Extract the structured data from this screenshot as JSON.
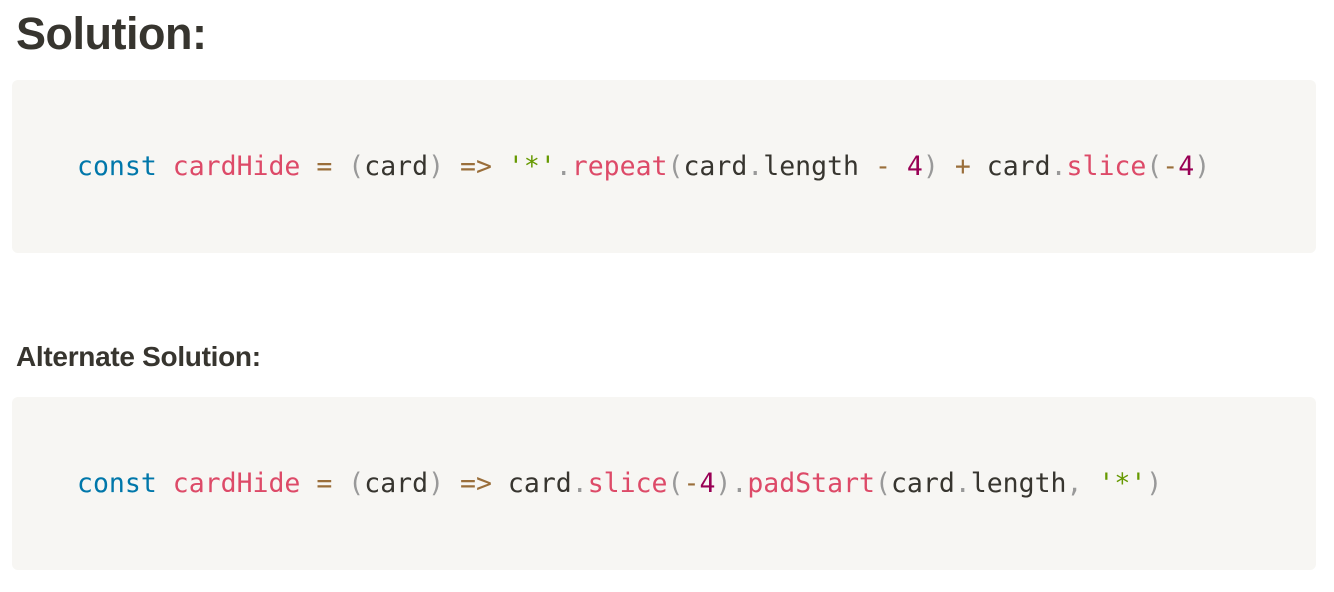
{
  "solution_heading": "Solution:",
  "alternate_heading": "Alternate Solution:",
  "code_blocks": [
    {
      "tokens": [
        {
          "text": "const",
          "kind": "kw"
        },
        {
          "text": " ",
          "kind": "id"
        },
        {
          "text": "cardHide",
          "kind": "fn"
        },
        {
          "text": " ",
          "kind": "id"
        },
        {
          "text": "=",
          "kind": "op"
        },
        {
          "text": " ",
          "kind": "id"
        },
        {
          "text": "(",
          "kind": "punc"
        },
        {
          "text": "card",
          "kind": "id"
        },
        {
          "text": ")",
          "kind": "punc"
        },
        {
          "text": " ",
          "kind": "id"
        },
        {
          "text": "=>",
          "kind": "op"
        },
        {
          "text": " ",
          "kind": "id"
        },
        {
          "text": "'*'",
          "kind": "str"
        },
        {
          "text": ".",
          "kind": "punc"
        },
        {
          "text": "repeat",
          "kind": "fn"
        },
        {
          "text": "(",
          "kind": "punc"
        },
        {
          "text": "card",
          "kind": "id"
        },
        {
          "text": ".",
          "kind": "punc"
        },
        {
          "text": "length",
          "kind": "id"
        },
        {
          "text": " ",
          "kind": "id"
        },
        {
          "text": "-",
          "kind": "op"
        },
        {
          "text": " ",
          "kind": "id"
        },
        {
          "text": "4",
          "kind": "num"
        },
        {
          "text": ")",
          "kind": "punc"
        },
        {
          "text": " ",
          "kind": "id"
        },
        {
          "text": "+",
          "kind": "op"
        },
        {
          "text": " ",
          "kind": "id"
        },
        {
          "text": "card",
          "kind": "id"
        },
        {
          "text": ".",
          "kind": "punc"
        },
        {
          "text": "slice",
          "kind": "fn"
        },
        {
          "text": "(",
          "kind": "punc"
        },
        {
          "text": "-",
          "kind": "op"
        },
        {
          "text": "4",
          "kind": "num"
        },
        {
          "text": ")",
          "kind": "punc"
        }
      ]
    },
    {
      "tokens": [
        {
          "text": "const",
          "kind": "kw"
        },
        {
          "text": " ",
          "kind": "id"
        },
        {
          "text": "cardHide",
          "kind": "fn"
        },
        {
          "text": " ",
          "kind": "id"
        },
        {
          "text": "=",
          "kind": "op"
        },
        {
          "text": " ",
          "kind": "id"
        },
        {
          "text": "(",
          "kind": "punc"
        },
        {
          "text": "card",
          "kind": "id"
        },
        {
          "text": ")",
          "kind": "punc"
        },
        {
          "text": " ",
          "kind": "id"
        },
        {
          "text": "=>",
          "kind": "op"
        },
        {
          "text": " ",
          "kind": "id"
        },
        {
          "text": "card",
          "kind": "id"
        },
        {
          "text": ".",
          "kind": "punc"
        },
        {
          "text": "slice",
          "kind": "fn"
        },
        {
          "text": "(",
          "kind": "punc"
        },
        {
          "text": "-",
          "kind": "op"
        },
        {
          "text": "4",
          "kind": "num"
        },
        {
          "text": ")",
          "kind": "punc"
        },
        {
          "text": ".",
          "kind": "punc"
        },
        {
          "text": "padStart",
          "kind": "fn"
        },
        {
          "text": "(",
          "kind": "punc"
        },
        {
          "text": "card",
          "kind": "id"
        },
        {
          "text": ".",
          "kind": "punc"
        },
        {
          "text": "length",
          "kind": "id"
        },
        {
          "text": ",",
          "kind": "punc"
        },
        {
          "text": " ",
          "kind": "id"
        },
        {
          "text": "'*'",
          "kind": "str"
        },
        {
          "text": ")",
          "kind": "punc"
        }
      ]
    }
  ],
  "colors": {
    "code_background": "#f7f6f3",
    "heading_text": "#37352f",
    "keyword": "#0077aa",
    "function": "#dd4a68",
    "operator": "#9a6e3a",
    "punctuation": "#999999",
    "string": "#669900",
    "number": "#990055"
  }
}
